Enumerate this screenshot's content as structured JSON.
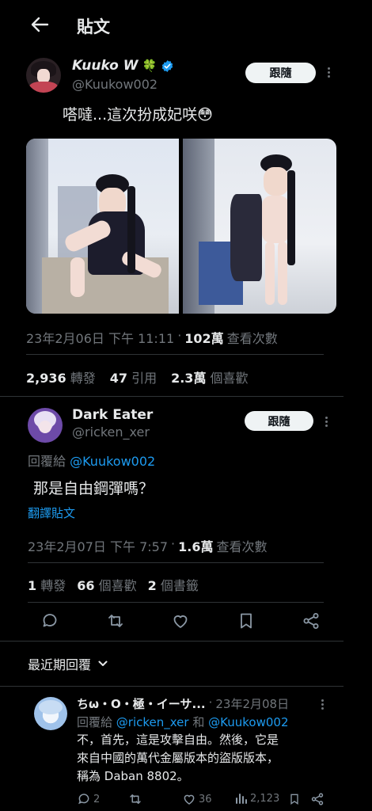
{
  "header": {
    "title": "貼文"
  },
  "post": {
    "author_name": "Kuuko W",
    "author_emoji": "🍀",
    "handle": "@Kuukow002",
    "follow_label": "跟隨",
    "text": "嗒噠...這次扮成妃咲😳",
    "meta_date": "23年2月06日 下午 11:11",
    "meta_sep": "·",
    "views": "102萬",
    "views_label": "查看次數",
    "stats": [
      {
        "num": "2,936",
        "label": "轉發"
      },
      {
        "num": "47",
        "label": "引用"
      },
      {
        "num": "2.3萬",
        "label": "個喜歡"
      }
    ]
  },
  "reply": {
    "author_name": "Dark Eater",
    "handle": "@ricken_xer",
    "follow_label": "跟隨",
    "reply_to_prefix": "回覆給",
    "reply_to_handle": "@Kuukow002",
    "text": "那是自由鋼彈嗎？",
    "translate": "翻譯貼文",
    "meta_date": "23年2月07日 下午 7:57",
    "meta_sep": "·",
    "views": "1.6萬",
    "views_label": "查看次數",
    "stats": [
      {
        "num": "1",
        "label": "轉發"
      },
      {
        "num": "66",
        "label": "個喜歡"
      },
      {
        "num": "2",
        "label": "個書籤"
      }
    ]
  },
  "sort": {
    "label": "最近期回覆"
  },
  "comment": {
    "author_name": "ちω・O・極・イーサ...",
    "sep": "·",
    "date": "23年2月08日",
    "reply_to_prefix": "回覆給",
    "reply_to_handle1": "@ricken_xer",
    "and": "和",
    "reply_to_handle2": "@Kuukow002",
    "line1": "不，首先，這是攻擊自由。然後，它是",
    "line2": "來自中國的萬代金屬版本的盜版版本，",
    "line3": "稱為 Daban 8802。",
    "replies": "2",
    "likes": "36",
    "views": "2,123"
  },
  "colors": {
    "accent": "#1d9bf0",
    "background": "#000000",
    "verified": "#1d9bf0"
  }
}
